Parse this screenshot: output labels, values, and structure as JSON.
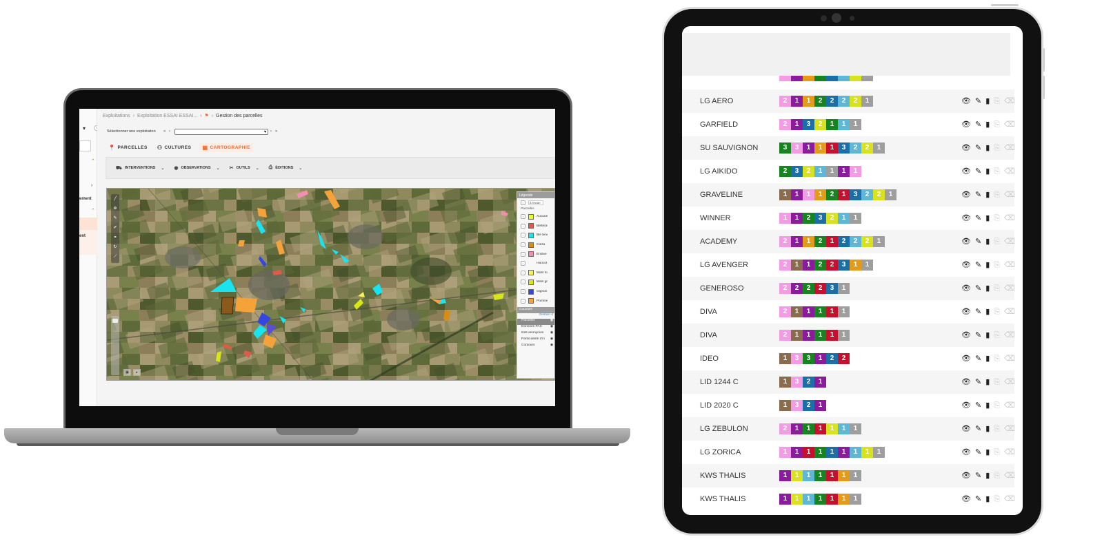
{
  "laptop": {
    "breadcrumb": [
      "Exploitations",
      "Exploitation ESSAI ESSAI...",
      "Gestion des parcelles"
    ],
    "sidebar": {
      "labels": [
        "ement",
        "ent"
      ]
    },
    "selector_label": "Sélectionner une exploitation",
    "tabs": [
      {
        "label": "PARCELLES",
        "icon": "map-pin-icon",
        "active": false
      },
      {
        "label": "CULTURES",
        "icon": "users-icon",
        "active": false
      },
      {
        "label": "CARTOGRAPHIE",
        "icon": "map-icon",
        "active": true
      }
    ],
    "toolbar": [
      {
        "label": "INTERVENTIONS",
        "icon": "tractor-icon"
      },
      {
        "label": "OBSERVATIONS",
        "icon": "eye-icon"
      },
      {
        "label": "OUTILS",
        "icon": "tools-icon"
      },
      {
        "label": "ÉDITIONS",
        "icon": "printer-icon"
      }
    ],
    "legend": {
      "title": "Légende",
      "search_value": "À l'écran",
      "parcelles_label": "Parcelles",
      "items": [
        {
          "label": "Aucune",
          "color": "#e8ff2e"
        },
        {
          "label": "Betterave",
          "color": "#e05a4a"
        },
        {
          "label": "Blé tendre",
          "color": "#19e3ef"
        },
        {
          "label": "Colza",
          "color": "#d98c12"
        },
        {
          "label": "Endive",
          "color": "#f28fb0"
        },
        {
          "label": "Haricot",
          "color": ""
        },
        {
          "label": "Maïs fourrage",
          "color": "#f2f25a"
        },
        {
          "label": "Maïs grain",
          "color": "#d7e614"
        },
        {
          "label": "Oignon (bulbille)",
          "color": "#3447e0"
        },
        {
          "label": "Pomme de terre transf.",
          "color": "#f5a23a"
        }
      ],
      "couches_title": "Couches",
      "couches_link": "Gestion d",
      "couches": [
        "Parcelles",
        "Données PAC",
        "Ilots anonymes",
        "Particularité d'intérêt écologique",
        "Contours"
      ]
    }
  },
  "tablet": {
    "palette": {
      "1p": "#f9a3f0",
      "2p": "#f28fe8",
      "1v": "#8c1a9e",
      "2v": "#7c1a96",
      "or": "#e59b18",
      "gr": "#17851f",
      "bl": "#1b6fa8",
      "lb": "#5db8d8",
      "ye": "#d9e21f",
      "gy": "#9e9e9e",
      "br": "#8a6b4e",
      "rd": "#c8102e",
      "dk": "#3a3a3a"
    },
    "rows": [
      {
        "name": "LG AERO",
        "cells": [
          [
            "2",
            "#f39be5"
          ],
          [
            "1",
            "#8c1a9e"
          ],
          [
            "1",
            "#e59b18"
          ],
          [
            "2",
            "#17851f"
          ],
          [
            "2",
            "#1b6fa8"
          ],
          [
            "2",
            "#5db8d8"
          ],
          [
            "2",
            "#d9e21f"
          ],
          [
            "1",
            "#9e9e9e"
          ]
        ]
      },
      {
        "name": "GARFIELD",
        "cells": [
          [
            "2",
            "#f39be5"
          ],
          [
            "1",
            "#8c1a9e"
          ],
          [
            "3",
            "#1b6fa8"
          ],
          [
            "2",
            "#d9e21f"
          ],
          [
            "1",
            "#17851f"
          ],
          [
            "1",
            "#5db8d8"
          ],
          [
            "1",
            "#9e9e9e"
          ]
        ]
      },
      {
        "name": "SU SAUVIGNON",
        "cells": [
          [
            "3",
            "#17851f"
          ],
          [
            "3",
            "#f39be5"
          ],
          [
            "1",
            "#8c1a9e"
          ],
          [
            "1",
            "#e59b18"
          ],
          [
            "1",
            "#c8102e"
          ],
          [
            "3",
            "#1b6fa8"
          ],
          [
            "2",
            "#5db8d8"
          ],
          [
            "2",
            "#d9e21f"
          ],
          [
            "1",
            "#9e9e9e"
          ]
        ]
      },
      {
        "name": "LG AIKIDO",
        "cells": [
          [
            "2",
            "#17851f"
          ],
          [
            "3",
            "#1b6fa8"
          ],
          [
            "2",
            "#d9e21f"
          ],
          [
            "1",
            "#5db8d8"
          ],
          [
            "1",
            "#9e9e9e"
          ],
          [
            "1",
            "#8c1a9e"
          ],
          [
            "1",
            "#f39be5"
          ]
        ]
      },
      {
        "name": "GRAVELINE",
        "cells": [
          [
            "1",
            "#8a6b4e"
          ],
          [
            "1",
            "#8c1a9e"
          ],
          [
            "1",
            "#f39be5"
          ],
          [
            "1",
            "#e59b18"
          ],
          [
            "2",
            "#17851f"
          ],
          [
            "1",
            "#c8102e"
          ],
          [
            "3",
            "#1b6fa8"
          ],
          [
            "2",
            "#5db8d8"
          ],
          [
            "2",
            "#d9e21f"
          ],
          [
            "1",
            "#9e9e9e"
          ]
        ]
      },
      {
        "name": "WINNER",
        "cells": [
          [
            "1",
            "#f39be5"
          ],
          [
            "1",
            "#8c1a9e"
          ],
          [
            "2",
            "#17851f"
          ],
          [
            "3",
            "#1b6fa8"
          ],
          [
            "2",
            "#d9e21f"
          ],
          [
            "1",
            "#5db8d8"
          ],
          [
            "1",
            "#9e9e9e"
          ]
        ]
      },
      {
        "name": "ACADEMY",
        "cells": [
          [
            "2",
            "#f39be5"
          ],
          [
            "1",
            "#8c1a9e"
          ],
          [
            "1",
            "#e59b18"
          ],
          [
            "2",
            "#17851f"
          ],
          [
            "1",
            "#c8102e"
          ],
          [
            "2",
            "#1b6fa8"
          ],
          [
            "2",
            "#5db8d8"
          ],
          [
            "2",
            "#d9e21f"
          ],
          [
            "1",
            "#9e9e9e"
          ]
        ]
      },
      {
        "name": "LG AVENGER",
        "cells": [
          [
            "2",
            "#f39be5"
          ],
          [
            "1",
            "#8a6b4e"
          ],
          [
            "1",
            "#8c1a9e"
          ],
          [
            "2",
            "#17851f"
          ],
          [
            "2",
            "#c8102e"
          ],
          [
            "3",
            "#1b6fa8"
          ],
          [
            "1",
            "#e59b18"
          ],
          [
            "1",
            "#9e9e9e"
          ]
        ]
      },
      {
        "name": "GENEROSO",
        "cells": [
          [
            "2",
            "#f39be5"
          ],
          [
            "2",
            "#8c1a9e"
          ],
          [
            "2",
            "#17851f"
          ],
          [
            "2",
            "#c8102e"
          ],
          [
            "3",
            "#1b6fa8"
          ],
          [
            "1",
            "#9e9e9e"
          ]
        ]
      },
      {
        "name": "DIVA",
        "cells": [
          [
            "2",
            "#f39be5"
          ],
          [
            "1",
            "#8a6b4e"
          ],
          [
            "1",
            "#8c1a9e"
          ],
          [
            "1",
            "#17851f"
          ],
          [
            "1",
            "#c8102e"
          ],
          [
            "1",
            "#9e9e9e"
          ]
        ]
      },
      {
        "name": "DIVA",
        "cells": [
          [
            "2",
            "#f39be5"
          ],
          [
            "1",
            "#8a6b4e"
          ],
          [
            "1",
            "#8c1a9e"
          ],
          [
            "1",
            "#17851f"
          ],
          [
            "1",
            "#c8102e"
          ],
          [
            "1",
            "#9e9e9e"
          ]
        ]
      },
      {
        "name": "IDEO",
        "cells": [
          [
            "1",
            "#8a6b4e"
          ],
          [
            "3",
            "#f39be5"
          ],
          [
            "3",
            "#17851f"
          ],
          [
            "1",
            "#8c1a9e"
          ],
          [
            "2",
            "#1b6fa8"
          ],
          [
            "2",
            "#c8102e"
          ]
        ]
      },
      {
        "name": "LID 1244 C",
        "cells": [
          [
            "1",
            "#8a6b4e"
          ],
          [
            "3",
            "#f39be5"
          ],
          [
            "2",
            "#1b6fa8"
          ],
          [
            "1",
            "#8c1a9e"
          ]
        ]
      },
      {
        "name": "LID 2020 C",
        "cells": [
          [
            "1",
            "#8a6b4e"
          ],
          [
            "3",
            "#f39be5"
          ],
          [
            "2",
            "#1b6fa8"
          ],
          [
            "1",
            "#8c1a9e"
          ]
        ]
      },
      {
        "name": "LG ZEBULON",
        "cells": [
          [
            "2",
            "#f39be5"
          ],
          [
            "1",
            "#8c1a9e"
          ],
          [
            "1",
            "#17851f"
          ],
          [
            "1",
            "#c8102e"
          ],
          [
            "1",
            "#d9e21f"
          ],
          [
            "1",
            "#5db8d8"
          ],
          [
            "1",
            "#9e9e9e"
          ]
        ]
      },
      {
        "name": "LG ZORICA",
        "cells": [
          [
            "1",
            "#f39be5"
          ],
          [
            "1",
            "#8c1a9e"
          ],
          [
            "1",
            "#c8102e"
          ],
          [
            "1",
            "#17851f"
          ],
          [
            "1",
            "#1b6fa8"
          ],
          [
            "1",
            "#8c1a9e"
          ],
          [
            "1",
            "#5db8d8"
          ],
          [
            "1",
            "#d9e21f"
          ],
          [
            "1",
            "#9e9e9e"
          ]
        ]
      },
      {
        "name": "KWS THALIS",
        "cells": [
          [
            "1",
            "#8c1a9e"
          ],
          [
            "1",
            "#d9e21f"
          ],
          [
            "1",
            "#5db8d8"
          ],
          [
            "1",
            "#17851f"
          ],
          [
            "1",
            "#c8102e"
          ],
          [
            "1",
            "#e59b18"
          ],
          [
            "1",
            "#9e9e9e"
          ]
        ]
      },
      {
        "name": "KWS THALIS",
        "cells": [
          [
            "1",
            "#8c1a9e"
          ],
          [
            "1",
            "#d9e21f"
          ],
          [
            "1",
            "#5db8d8"
          ],
          [
            "1",
            "#17851f"
          ],
          [
            "1",
            "#c8102e"
          ],
          [
            "1",
            "#e59b18"
          ],
          [
            "1",
            "#9e9e9e"
          ]
        ]
      }
    ],
    "partial_row_colors": [
      "#f39be5",
      "#8c1a9e",
      "#e59b18",
      "#17851f",
      "#1b6fa8",
      "#5db8d8",
      "#d9e21f",
      "#9e9e9e"
    ],
    "actions": [
      {
        "icon": "eye-icon",
        "glyph": "👁"
      },
      {
        "icon": "pencil-icon",
        "glyph": "✎"
      },
      {
        "icon": "book-icon",
        "glyph": "▮"
      },
      {
        "icon": "copy-icon",
        "glyph": "⎘"
      },
      {
        "icon": "delete-icon",
        "glyph": "⌫"
      }
    ]
  }
}
